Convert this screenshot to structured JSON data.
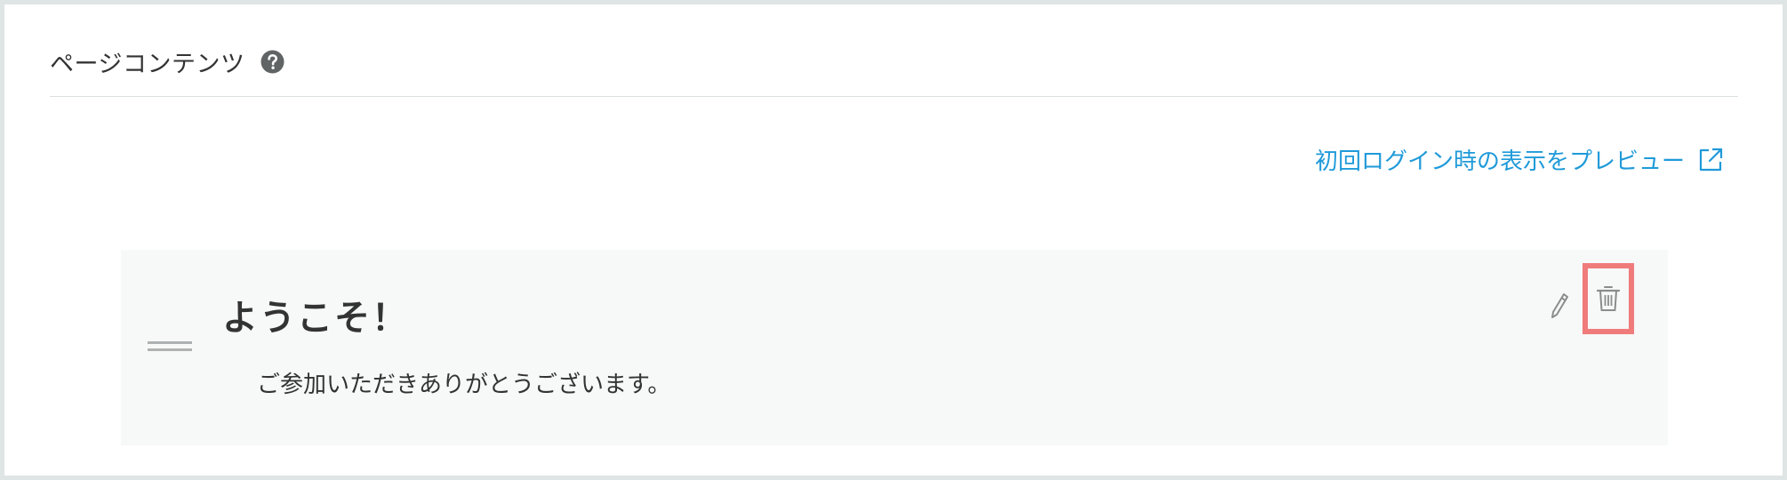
{
  "section": {
    "title": "ページコンテンツ",
    "help_icon": "question-circle-icon"
  },
  "preview": {
    "label": "初回ログイン時の表示をプレビュー",
    "icon": "external-link-icon"
  },
  "card": {
    "heading": "ようこそ！",
    "body": "ご参加いただきありがとうございます。",
    "drag_icon": "drag-handle-icon",
    "edit_icon": "pencil-icon",
    "delete_icon": "trash-icon"
  },
  "colors": {
    "link": "#1f9ad9",
    "text": "#333333",
    "card_background": "#f7f8f8",
    "highlight": "#f07b7b",
    "icon_gray": "#8c8c8c"
  }
}
